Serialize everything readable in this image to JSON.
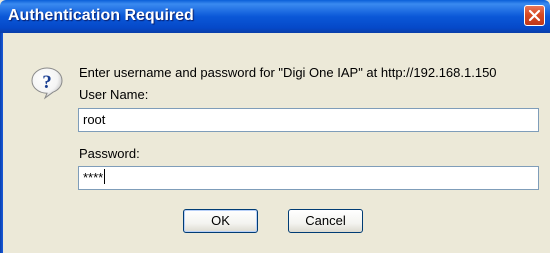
{
  "dialog": {
    "title": "Authentication Required",
    "message": "Enter username and password for \"Digi One IAP\" at http://192.168.1.150",
    "username_label": "User Name:",
    "username_value": "root",
    "password_label": "Password:",
    "password_value": "****",
    "ok_label": "OK",
    "cancel_label": "Cancel",
    "icon": "question-icon"
  },
  "colors": {
    "titlebar": "#0b58d8",
    "dialog_background": "#ece9d8",
    "close_button": "#d84a22",
    "input_border": "#7f9db9",
    "button_border": "#003c74"
  }
}
